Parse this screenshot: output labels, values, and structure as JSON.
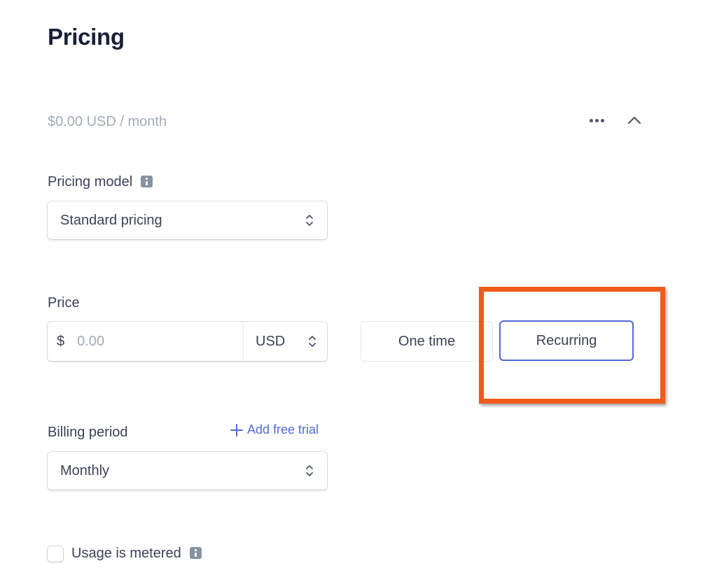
{
  "header": {
    "title": "Pricing",
    "summary": "$0.00 USD / month",
    "more_icon": "more-horizontal-icon",
    "collapse_icon": "chevron-up-icon"
  },
  "pricing_model": {
    "label": "Pricing model",
    "info_icon": "info-icon",
    "selected": "Standard pricing"
  },
  "price": {
    "label": "Price",
    "currency_symbol": "$",
    "amount_value": "",
    "amount_placeholder": "0.00",
    "currency": "USD"
  },
  "price_type": {
    "options": [
      {
        "label": "One time",
        "selected": false
      },
      {
        "label": "Recurring",
        "selected": true
      }
    ],
    "highlight_color": "#f05a1a",
    "selected_border_color": "#5469d4"
  },
  "billing_period": {
    "label": "Billing period",
    "add_trial_label": "Add free trial",
    "selected": "Monthly"
  },
  "metered": {
    "label": "Usage is metered",
    "checked": false
  }
}
